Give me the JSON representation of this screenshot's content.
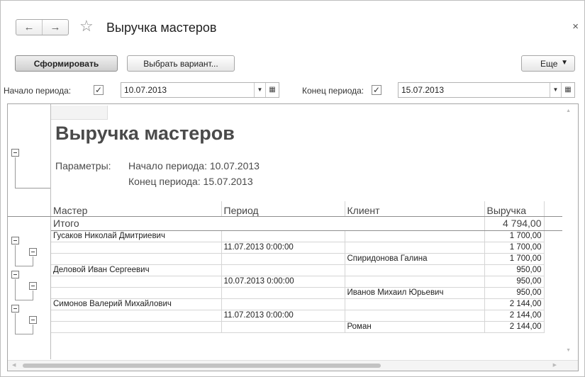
{
  "window": {
    "title": "Выручка мастеров",
    "close": "×"
  },
  "nav": {
    "back": "←",
    "forward": "→",
    "favorite": "☆"
  },
  "toolbar": {
    "generate": "Сформировать",
    "choose_variant": "Выбрать вариант...",
    "more": "Еще",
    "more_caret": "▼"
  },
  "period": {
    "start_label": "Начало периода:",
    "start_checked": "✓",
    "start_value": "10.07.2013",
    "end_label": "Конец периода:",
    "end_checked": "✓",
    "end_value": "15.07.2013",
    "dropdown": "▼",
    "calendar": "▦"
  },
  "report": {
    "title": "Выручка мастеров",
    "params_label": "Параметры:",
    "param_start": "Начало периода: 10.07.2013",
    "param_end": "Конец периода: 15.07.2013",
    "columns": [
      "Мастер",
      "Период",
      "Клиент",
      "Выручка"
    ],
    "total_label": "Итого",
    "total_value": "4 794,00",
    "rows": [
      [
        "Гусаков Николай Дмитриевич",
        "",
        "",
        "1 700,00"
      ],
      [
        "",
        "11.07.2013 0:00:00",
        "",
        "1 700,00"
      ],
      [
        "",
        "",
        "Спиридонова Галина",
        "1 700,00"
      ],
      [
        "Деловой Иван Сергеевич",
        "",
        "",
        "950,00"
      ],
      [
        "",
        "10.07.2013 0:00:00",
        "",
        "950,00"
      ],
      [
        "",
        "",
        "Иванов Михаил Юрьевич",
        "950,00"
      ],
      [
        "Симонов Валерий Михайлович",
        "",
        "",
        "2 144,00"
      ],
      [
        "",
        "11.07.2013 0:00:00",
        "",
        "2 144,00"
      ],
      [
        "",
        "",
        "Роман",
        "2 144,00"
      ]
    ]
  },
  "icons": {
    "collapse": "minus-box-icon",
    "scroll_up": "▲",
    "scroll_down": "▼",
    "scroll_left": "◀",
    "scroll_right": "▶"
  }
}
